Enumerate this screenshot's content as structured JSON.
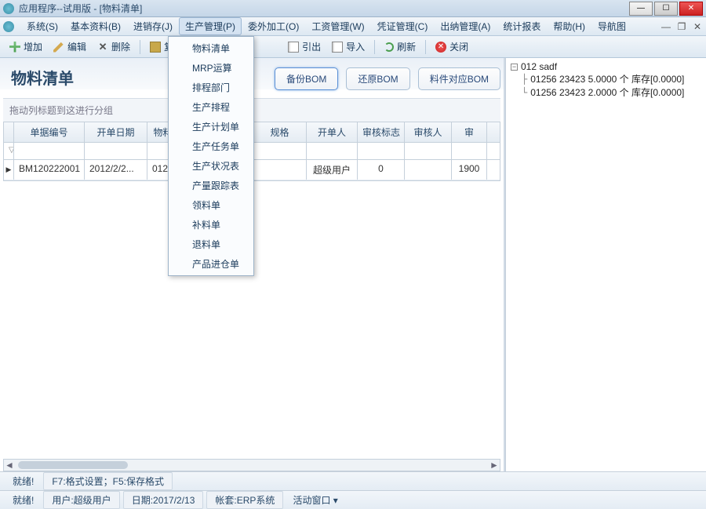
{
  "window": {
    "title": "应用程序--试用版 - [物料清单]"
  },
  "menus": [
    "系统(S)",
    "基本资料(B)",
    "进销存(J)",
    "生产管理(P)",
    "委外加工(O)",
    "工资管理(W)",
    "凭证管理(C)",
    "出纳管理(A)",
    "统计报表",
    "帮助(H)",
    "导航图"
  ],
  "activeMenuIndex": 3,
  "dropdown": [
    "物料清单",
    "MRP运算",
    "排程部门",
    "生产排程",
    "生产计划单",
    "生产任务单",
    "生产状况表",
    "产量跟踪表",
    "领料单",
    "补料单",
    "退料单",
    "产品进仓单"
  ],
  "toolbar": {
    "add": "增加",
    "edit": "编辑",
    "delete": "删除",
    "copy": "复制",
    "export": "引出",
    "import": "导入",
    "refresh": "刷新",
    "close": "关闭"
  },
  "page": {
    "title": "物料清单",
    "groupHint": "拖动列标题到这进行分组"
  },
  "bomButtons": {
    "backup": "备份BOM",
    "restore": "还原BOM",
    "match": "料件对应BOM"
  },
  "columns": [
    "单据编号",
    "开单日期",
    "物料",
    "规格",
    "开单人",
    "审核标志",
    "审核人",
    "审"
  ],
  "row": {
    "billNo": "BM120222001",
    "date": "2012/2/2...",
    "material": "012",
    "spec": "",
    "creator": "超级用户",
    "auditFlag": "0",
    "auditor": "",
    "audit": "1900"
  },
  "tree": {
    "root": "012 sadf",
    "children": [
      "01256 23423  5.0000 个 库存[0.0000]",
      "01256 23423  2.0000 个 库存[0.0000]"
    ]
  },
  "status1": {
    "ready": "就绪!",
    "hint": "F7:格式设置；F5:保存格式"
  },
  "status2": {
    "ready": "就绪!",
    "user": "用户:超级用户",
    "date": "日期:2017/2/13",
    "acct": "帐套:ERP系统",
    "win": "活动窗口 ▾"
  }
}
